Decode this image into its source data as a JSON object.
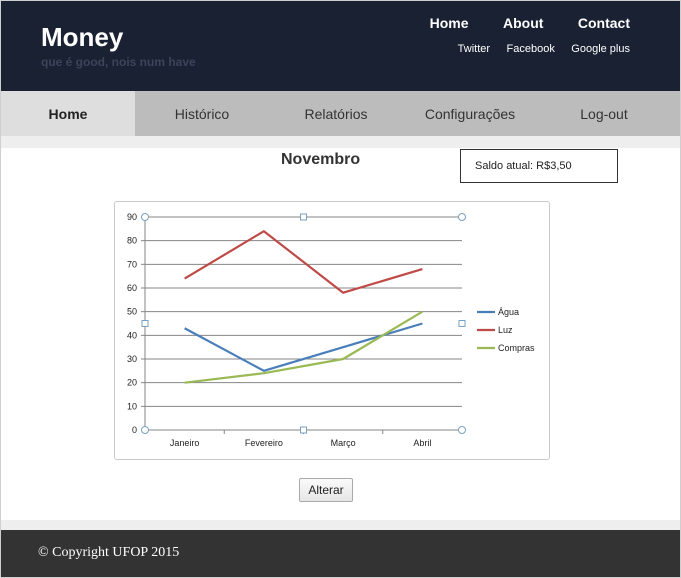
{
  "header": {
    "title": "Money",
    "subtitle": "que é good, nois num have",
    "top_links": [
      "Home",
      "About",
      "Contact"
    ],
    "social_links": [
      "Twitter",
      "Facebook",
      "Google plus"
    ]
  },
  "nav": {
    "tabs": [
      "Home",
      "Histórico",
      "Relatórios",
      "Configurações",
      "Log-out"
    ],
    "active": "Home"
  },
  "main": {
    "month_title": "Novembro",
    "balance_label": "Saldo atual: R$3,50",
    "alter_button": "Alterar"
  },
  "chart_data": {
    "type": "line",
    "categories": [
      "Janeiro",
      "Fevereiro",
      "Março",
      "Abril"
    ],
    "series": [
      {
        "name": "Água",
        "values": [
          43,
          25,
          35,
          45
        ],
        "color": "#4a7ebb"
      },
      {
        "name": "Luz",
        "values": [
          64,
          84,
          58,
          68
        ],
        "color": "#be4b48"
      },
      {
        "name": "Compras",
        "values": [
          20,
          24,
          30,
          50
        ],
        "color": "#98b954"
      }
    ],
    "ylim": [
      0,
      90
    ],
    "yticks": [
      0,
      10,
      20,
      30,
      40,
      50,
      60,
      70,
      80,
      90
    ],
    "grid": true,
    "legend": "right"
  },
  "footer": {
    "copyright": "© Copyright UFOP 2015"
  }
}
